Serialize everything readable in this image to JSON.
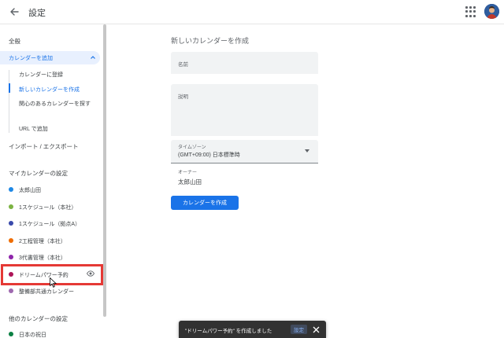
{
  "topbar": {
    "title": "設定",
    "back_icon": "arrow-left-icon",
    "apps_icon": "apps-grid-icon",
    "avatar_icon": "user-avatar"
  },
  "sidebar": {
    "general": "全般",
    "add_calendar": "カレンダーを追加",
    "subscribe": "カレンダーに登録",
    "create_new": "新しいカレンダーを作成",
    "browse_interesting": "関心のあるカレンダーを探す",
    "from_url": "URL で追加",
    "import_export": "インポート / エクスポート",
    "my_calendars_settings": "マイカレンダーの設定",
    "my_calendars": [
      {
        "label": "太郎山田",
        "color": "#1e88e5"
      },
      {
        "label": "1スケジュール（本社）",
        "color": "#7cb342"
      },
      {
        "label": "1スケジュール（拠点A）",
        "color": "#3949ab"
      },
      {
        "label": "2工程管理（本社）",
        "color": "#ef6c00"
      },
      {
        "label": "3代書管理（本社）",
        "color": "#8e24aa"
      },
      {
        "label": "ドリームパワー予約",
        "color": "#ad1457"
      },
      {
        "label": "整備部共通カレンダー",
        "color": "#9e69af"
      }
    ],
    "other_calendars_settings": "他のカレンダーの設定",
    "other_calendars": [
      {
        "label": "日本の祝日",
        "color": "#0b8043"
      }
    ]
  },
  "form": {
    "title": "新しいカレンダーを作成",
    "name_label": "名前",
    "description_label": "説明",
    "timezone_label": "タイムゾーン",
    "timezone_value": "(GMT+09:00) 日本標準時",
    "owner_label": "オーナー",
    "owner_value": "太郎山田",
    "create_button": "カレンダーを作成"
  },
  "snackbar": {
    "message": "\"ドリームパワー予約\" を作成しました",
    "action": "設定"
  },
  "colors": {
    "accent": "#1a73e8",
    "active_bg": "#e8f0fe",
    "highlight_border": "#e53935",
    "snackbar_bg": "#323232"
  }
}
